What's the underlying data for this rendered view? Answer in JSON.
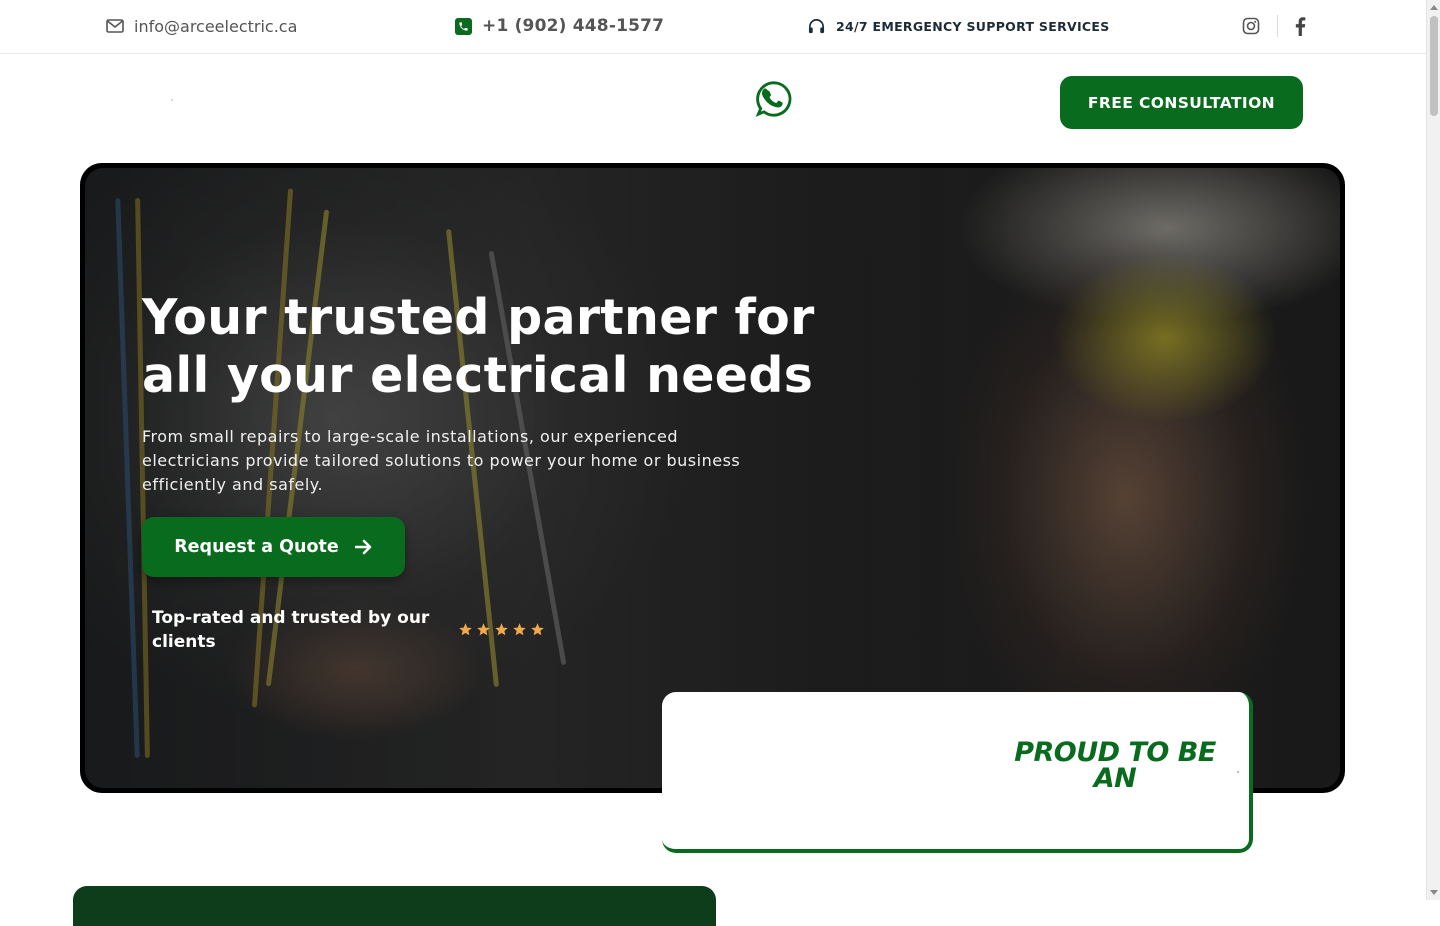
{
  "topbar": {
    "email": "info@arceelectric.ca",
    "phone": "+1 (902) 448-1577",
    "support": "24/7 EMERGENCY SUPPORT SERVICES",
    "social_icons": [
      "instagram-icon",
      "facebook-icon"
    ]
  },
  "header": {
    "cta_label": "FREE CONSULTATION",
    "whatsapp_icon": "whatsapp-icon"
  },
  "hero": {
    "title": "Your trusted partner for all your electrical needs",
    "description": "From small repairs to large-scale installations, our experienced electricians provide tailored solutions to power your home or business efficiently and safely.",
    "button_label": "Request a Quote",
    "rated_text": "Top-rated and trusted by our clients",
    "rating": 5
  },
  "proud_card": {
    "text": "PROUD TO BE AN"
  },
  "colors": {
    "brand_green": "#086b1d",
    "star": "#f0a94a",
    "dark_green": "#0e3d1b"
  }
}
